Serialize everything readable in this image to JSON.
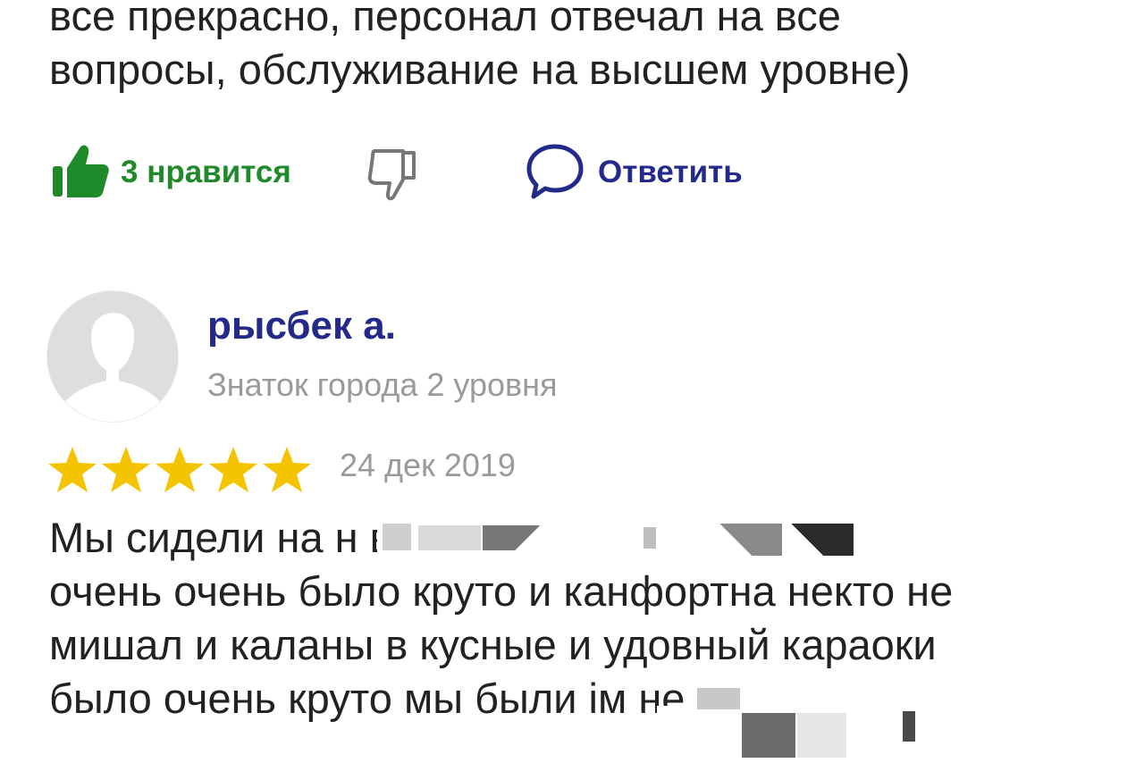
{
  "previous_review": {
    "text_lines": [
      "все прекрасно, персонал отвечал на все",
      "вопросы, обслуживание на высшем уровне)"
    ],
    "actions": {
      "like_label": "3 нравится",
      "reply_label": "Ответить"
    }
  },
  "review": {
    "author_name": "рысбек а.",
    "author_level": "Знаток города 2 уровня",
    "rating": 5,
    "rating_max": 5,
    "date": "24 дек 2019",
    "text_lines": [
      "Мы сидели на н                                 в чера и",
      "очень очень было круто и канфортна некто не",
      "мишал и каланы в кусные и удовный караоки",
      "было очень круто мы были                             ім не"
    ]
  },
  "colors": {
    "like_green": "#1f8a2a",
    "link_blue": "#232a8a",
    "star_yellow": "#f5c400",
    "meta_gray": "#9a9a9a"
  },
  "icons": [
    "thumbs-up-icon",
    "thumbs-down-icon",
    "speech-bubble-icon",
    "avatar-silhouette-icon",
    "star-icon"
  ]
}
